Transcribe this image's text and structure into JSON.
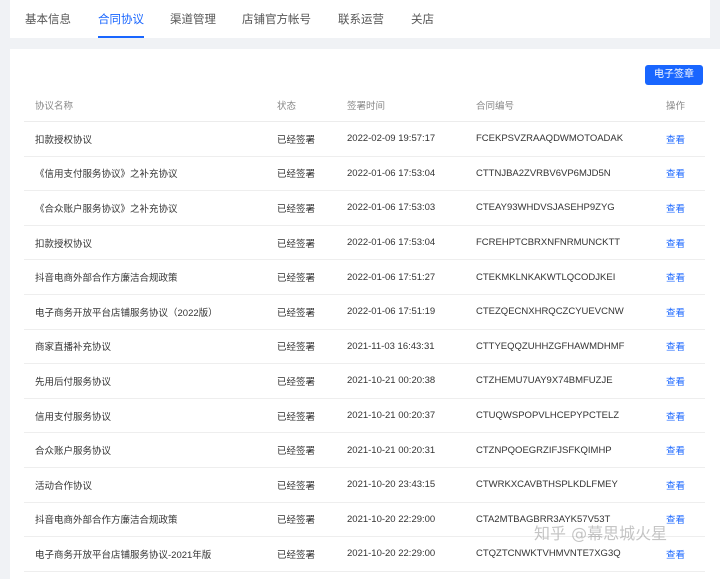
{
  "tabs": [
    {
      "label": "基本信息"
    },
    {
      "label": "合同协议",
      "active": true
    },
    {
      "label": "渠道管理"
    },
    {
      "label": "店铺官方帐号"
    },
    {
      "label": "联系运营"
    },
    {
      "label": "关店"
    }
  ],
  "toolbar": {
    "esign_label": "电子签章"
  },
  "table": {
    "headers": {
      "name": "协议名称",
      "status": "状态",
      "time": "签署时间",
      "code": "合同编号",
      "op": "操作"
    },
    "rows": [
      {
        "name": "扣款授权协议",
        "status": "已经签署",
        "time": "2022-02-09 19:57:17",
        "code": "FCEKPSVZRAAQDWMOTOADAK",
        "action": "查看"
      },
      {
        "name": "《信用支付服务协议》之补充协议",
        "status": "已经签署",
        "time": "2022-01-06 17:53:04",
        "code": "CTTNJBA2ZVRBV6VP6MJD5N",
        "action": "查看"
      },
      {
        "name": "《合众账户服务协议》之补充协议",
        "status": "已经签署",
        "time": "2022-01-06 17:53:03",
        "code": "CTEAY93WHDVSJASEHP9ZYG",
        "action": "查看"
      },
      {
        "name": "扣款授权协议",
        "status": "已经签署",
        "time": "2022-01-06 17:53:04",
        "code": "FCREHPTCBRXNFNRMUNCKTT",
        "action": "查看"
      },
      {
        "name": "抖音电商外部合作方廉洁合规政策",
        "status": "已经签署",
        "time": "2022-01-06 17:51:27",
        "code": "CTEKMKLNKAKWTLQCODJKEI",
        "action": "查看"
      },
      {
        "name": "电子商务开放平台店铺服务协议（2022版）",
        "status": "已经签署",
        "time": "2022-01-06 17:51:19",
        "code": "CTEZQECNXHRQCZCYUEVCNW",
        "action": "查看"
      },
      {
        "name": "商家直播补充协议",
        "status": "已经签署",
        "time": "2021-11-03 16:43:31",
        "code": "CTTYEQQZUHHZGFHAWMDHMF",
        "action": "查看"
      },
      {
        "name": "先用后付服务协议",
        "status": "已经签署",
        "time": "2021-10-21 00:20:38",
        "code": "CTZHEMU7UAY9X74BMFUZJE",
        "action": "查看"
      },
      {
        "name": "信用支付服务协议",
        "status": "已经签署",
        "time": "2021-10-21 00:20:37",
        "code": "CTUQWSPOPVLHCEPYPCTELZ",
        "action": "查看"
      },
      {
        "name": "合众账户服务协议",
        "status": "已经签署",
        "time": "2021-10-21 00:20:31",
        "code": "CTZNPQOEGRZIFJSFKQIMHP",
        "action": "查看"
      },
      {
        "name": "活动合作协议",
        "status": "已经签署",
        "time": "2021-10-20 23:43:15",
        "code": "CTWRKXCAVBTHSPLKDLFMEY",
        "action": "查看"
      },
      {
        "name": "抖音电商外部合作方廉洁合规政策",
        "status": "已经签署",
        "time": "2021-10-20 22:29:00",
        "code": "CTA2MTBAGBRR3AYK57V53T",
        "action": "查看"
      },
      {
        "name": "电子商务开放平台店铺服务协议-2021年版",
        "status": "已经签署",
        "time": "2021-10-20 22:29:00",
        "code": "CTQZTCNWKTVHMVNTE7XG3Q",
        "action": "查看"
      }
    ]
  },
  "watermark": "知乎 @幕思城火星"
}
